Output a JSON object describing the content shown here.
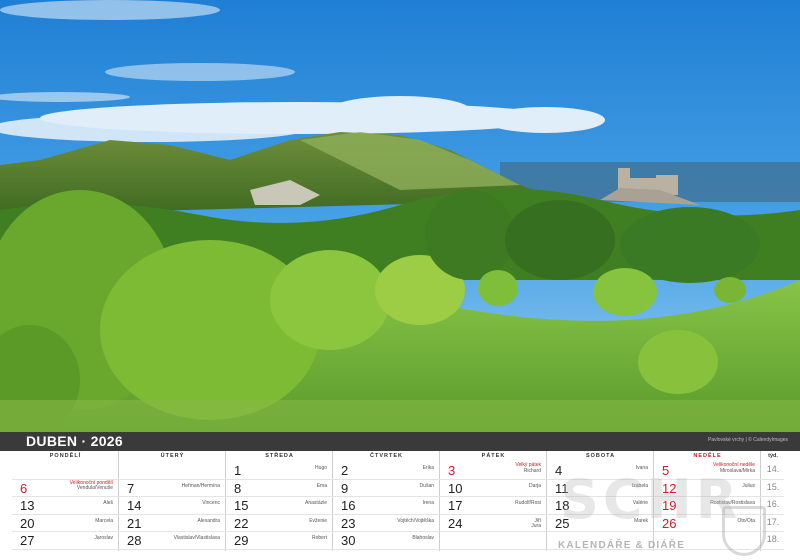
{
  "month": {
    "title": "DUBEN · 2026",
    "credit": "Pavlovské vrchy | © CalendyImages"
  },
  "weekdays": [
    "PONDĚLÍ",
    "ÚTERÝ",
    "STŘEDA",
    "ČTVRTEK",
    "PÁTEK",
    "SOBOTA",
    "NEDĚLE"
  ],
  "week_label": "týd.",
  "weeks": [
    {
      "week": "14.",
      "days": [
        {
          "num": "",
          "name": ""
        },
        {
          "num": "",
          "name": ""
        },
        {
          "num": "1",
          "name": "Hugo"
        },
        {
          "num": "2",
          "name": "Erika"
        },
        {
          "num": "3",
          "name": "Richard",
          "holiday": "Velký pátek",
          "red": true
        },
        {
          "num": "4",
          "name": "Ivana"
        },
        {
          "num": "5",
          "name": "Miroslava/Mirka",
          "holiday": "Velikonoční neděle",
          "red": true
        }
      ]
    },
    {
      "week": "15.",
      "days": [
        {
          "num": "6",
          "name": "Vendula/Venuše",
          "holiday": "Velikonoční pondělí",
          "red": true
        },
        {
          "num": "7",
          "name": "Heřman/Hermína"
        },
        {
          "num": "8",
          "name": "Ema"
        },
        {
          "num": "9",
          "name": "Dušan"
        },
        {
          "num": "10",
          "name": "Darja"
        },
        {
          "num": "11",
          "name": "Izabela"
        },
        {
          "num": "12",
          "name": "Julius",
          "red": true
        }
      ]
    },
    {
      "week": "16.",
      "days": [
        {
          "num": "13",
          "name": "Aleš"
        },
        {
          "num": "14",
          "name": "Vincenc"
        },
        {
          "num": "15",
          "name": "Anastázie"
        },
        {
          "num": "16",
          "name": "Irena"
        },
        {
          "num": "17",
          "name": "Rudolf/Rosi"
        },
        {
          "num": "18",
          "name": "Valérie"
        },
        {
          "num": "19",
          "name": "Rostislav/Rostislava",
          "red": true
        }
      ]
    },
    {
      "week": "17.",
      "days": [
        {
          "num": "20",
          "name": "Marcela"
        },
        {
          "num": "21",
          "name": "Alexandra"
        },
        {
          "num": "22",
          "name": "Evženie"
        },
        {
          "num": "23",
          "name": "Vojtěch/Vojtěška"
        },
        {
          "num": "24",
          "name": "Jiří\nJura"
        },
        {
          "num": "25",
          "name": "Marek"
        },
        {
          "num": "26",
          "name": "Oto/Ota",
          "red": true
        }
      ]
    },
    {
      "week": "18.",
      "days": [
        {
          "num": "27",
          "name": "Jaroslav"
        },
        {
          "num": "28",
          "name": "Vlastislav/Vlastislava"
        },
        {
          "num": "29",
          "name": "Robert"
        },
        {
          "num": "30",
          "name": "Blahoslav"
        },
        {
          "num": "",
          "name": ""
        },
        {
          "num": "",
          "name": ""
        },
        {
          "num": "",
          "name": ""
        }
      ]
    }
  ],
  "watermark": {
    "logo": "SCHR",
    "tagline": "KALENDÁŘE & DIÁŘE"
  },
  "colors": {
    "bar": "#3a3a3a",
    "holiday": "#d0192a",
    "sky": "#2a8ad6",
    "grass": "#6db83a"
  }
}
